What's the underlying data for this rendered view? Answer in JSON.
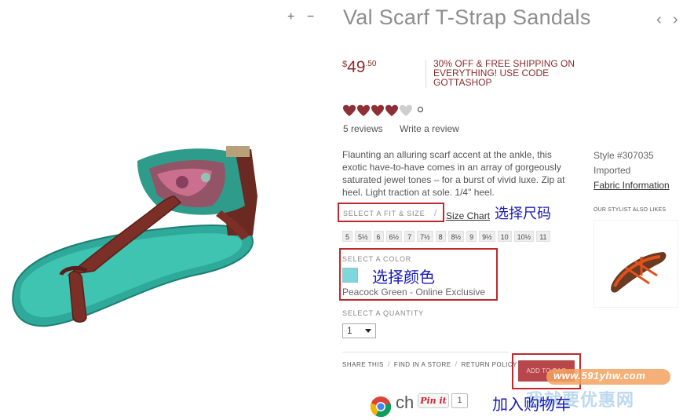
{
  "product": {
    "title": "Val Scarf T-Strap Sandals",
    "price_currency": "$",
    "price_dollars": "49",
    "price_cents": ".50",
    "promo": "30% OFF & FREE SHIPPING ON EVERYTHING! USE CODE GOTTASHOP",
    "rating_value": 4,
    "rating_max": 5,
    "reviews_count": "5 reviews",
    "write_review": "Write a review",
    "description": "Flaunting an alluring scarf accent at the ankle, this exotic have-to-have comes in an array of gorgeously saturated jewel tones – for a burst of vivid luxe. Zip at heel. Light traction at sole. 1/4\" heel.",
    "style_number": "Style #307035",
    "imported": "Imported",
    "fabric_info": "Fabric Information"
  },
  "zoom": {
    "in": "+",
    "out": "−"
  },
  "nav": {
    "prev": "‹",
    "next": "›"
  },
  "fit": {
    "label": "SELECT A FIT & SIZE",
    "slash": "/",
    "size_chart": "Size Chart",
    "sizes": [
      "5",
      "5½",
      "6",
      "6½",
      "7",
      "7½",
      "8",
      "8½",
      "9",
      "9½",
      "10",
      "10½",
      "11"
    ]
  },
  "color": {
    "label": "SELECT A COLOR",
    "swatch_hex": "#7dd8de",
    "selected_name": "Peacock Green - Online Exclusive"
  },
  "quantity": {
    "label": "SELECT A QUANTITY",
    "value": "1"
  },
  "actions": {
    "share": "SHARE THIS",
    "find_store": "FIND IN A STORE",
    "return_policy": "RETURN POLICY",
    "add_to_bag": "ADD TO BAG",
    "pinit": "Pin it",
    "pin_count": "1",
    "chrome_partial": "ch"
  },
  "stylist": {
    "label": "OUR STYLIST ALSO LIKES"
  },
  "annotations": {
    "size": "选择尺码",
    "color": "选择颜色",
    "bag": "加入购物车"
  },
  "watermark": {
    "url": "www.591yhw.com",
    "cn": "我就要优惠网"
  },
  "colors": {
    "price_red": "#8b2b2b",
    "annotation_blue": "#1a1ab8",
    "highlight_red": "#c0282d",
    "heart_filled": "#8e2e35",
    "heart_empty": "#cfcfcf"
  }
}
